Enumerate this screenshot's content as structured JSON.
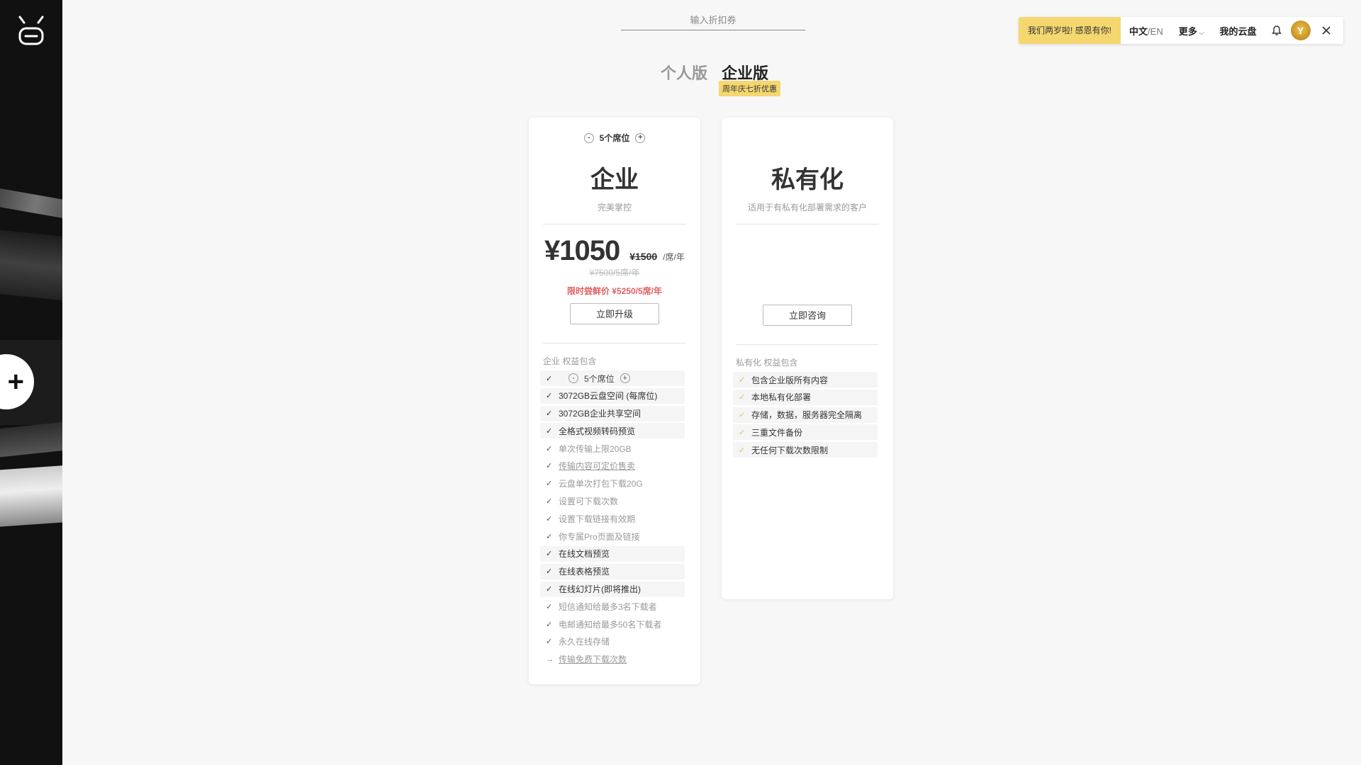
{
  "coupon": {
    "placeholder": "输入折扣券"
  },
  "topbar": {
    "promo": "我们两岁啦! 感恩有你!",
    "lang_zh": "中文",
    "lang_en": "/EN",
    "more": "更多",
    "more_chev": "⌵",
    "cloud": "我的云盘",
    "avatar_glyph": "Y"
  },
  "sidebar": {
    "add_glyph": "+"
  },
  "tabs": {
    "personal": "个人版",
    "enterprise": "企业版",
    "badge": "周年庆七折优惠"
  },
  "enterprise": {
    "seat_minus": "-",
    "seat_plus": "+",
    "seats": "5个席位",
    "title": "企业",
    "subtitle": "完美掌控",
    "price": "¥1050",
    "orig_price": "¥1500",
    "unit": "/席/年",
    "total_orig": "¥7500/5席/年",
    "promo_price": "限时尝鲜价 ¥5250/5席/年",
    "button": "立即升级",
    "benefit_head": "企业 权益包含",
    "features": [
      "5个席位",
      "3072GB云盘空间 (每席位)",
      "3072GB企业共享空间",
      "全格式视频转码预览",
      "单次传输上限20GB",
      "传输内容可定价售卖",
      "云盘单次打包下载20G",
      "设置可下载次数",
      "设置下载链接有效期",
      "你专属Pro页面及链接",
      "在线文档预览",
      "在线表格预览",
      "在线幻灯片(即将推出)",
      "短信通知给最多3名下载者",
      "电邮通知给最多50名下载者",
      "永久在线存储",
      "传输免费下载次数"
    ]
  },
  "private": {
    "title": "私有化",
    "subtitle": "适用于有私有化部署需求的客户",
    "button": "立即咨询",
    "benefit_head": "私有化 权益包含",
    "features": [
      "包含企业版所有内容",
      "本地私有化部署",
      "存储，数据，服务器完全隔离",
      "三重文件备份",
      "无任何下载次数限制"
    ]
  },
  "glyphs": {
    "check": "✓",
    "arrow": "→"
  }
}
